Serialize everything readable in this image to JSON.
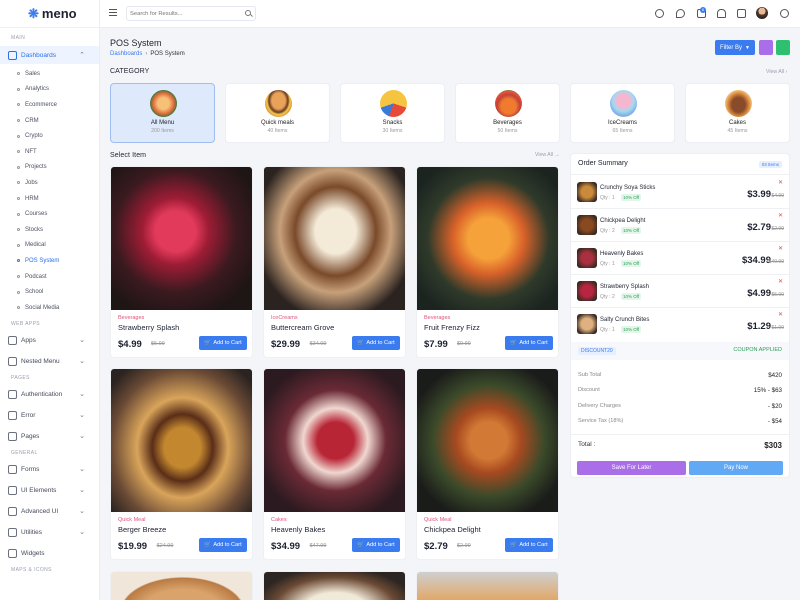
{
  "app": {
    "logo_text": "meno",
    "logo_mark": "❋"
  },
  "search": {
    "placeholder": "Search for Results..."
  },
  "topbar": {
    "notification_count": "6"
  },
  "sidebar": {
    "sections": {
      "main": "MAIN",
      "web_apps": "WEB APPS",
      "pages": "PAGES",
      "general": "GENERAL",
      "maps": "MAPS & ICONS"
    },
    "dashboards": "Dashboards",
    "sub_items": [
      "Sales",
      "Analytics",
      "Ecommerce",
      "CRM",
      "Crypto",
      "NFT",
      "Projects",
      "Jobs",
      "HRM",
      "Courses",
      "Stocks",
      "Medical",
      "POS System",
      "Podcast",
      "School",
      "Social Media"
    ],
    "apps": "Apps",
    "nested_menu": "Nested Menu",
    "authentication": "Authentication",
    "error": "Error",
    "pages": "Pages",
    "forms": "Forms",
    "ui_elements": "UI Elements",
    "advanced_ui": "Advanced UI",
    "utilities": "Utilities",
    "widgets": "Widgets"
  },
  "page": {
    "title": "POS System",
    "breadcrumb": [
      "Dashboards",
      "POS System"
    ],
    "filter_label": "Filter By",
    "category_heading": "CATEGORY",
    "select_heading": "Select Item",
    "view_all": "View All"
  },
  "categories": [
    {
      "name": "All Menu",
      "count": "200 Items"
    },
    {
      "name": "Quick meals",
      "count": "40 Items"
    },
    {
      "name": "Snacks",
      "count": "30 Items"
    },
    {
      "name": "Beverages",
      "count": "50 Items"
    },
    {
      "name": "IceCreams",
      "count": "65 Items"
    },
    {
      "name": "Cakes",
      "count": "45 Items"
    }
  ],
  "items": [
    {
      "category": "Beverages",
      "name": "Strawberry Splash",
      "price": "$4.99",
      "old_price": "$5.99"
    },
    {
      "category": "IceCreams",
      "name": "Buttercream Grove",
      "price": "$29.99",
      "old_price": "$34.99"
    },
    {
      "category": "Beverages",
      "name": "Fruit Frenzy Fizz",
      "price": "$7.99",
      "old_price": "$9.99"
    },
    {
      "category": "Quick Meal",
      "name": "Berger Breeze",
      "price": "$19.99",
      "old_price": "$24.99"
    },
    {
      "category": "Cakes",
      "name": "Heavenly Bakes",
      "price": "$34.99",
      "old_price": "$47.99"
    },
    {
      "category": "Quick Meal",
      "name": "Chickpea Delight",
      "price": "$2.79",
      "old_price": "$2.99"
    }
  ],
  "add_to_cart": "Add to Cart",
  "order": {
    "title": "Order Summary",
    "badge": "03 Items",
    "lines": [
      {
        "name": "Crunchy Soya Sticks",
        "qty": "Qty : 1",
        "off": "10% Off",
        "price": "$3.99",
        "old": "$4.99"
      },
      {
        "name": "Chickpea Delight",
        "qty": "Qty : 2",
        "off": "10% Off",
        "price": "$2.79",
        "old": "$2.99"
      },
      {
        "name": "Heavenly Bakes",
        "qty": "Qty : 1",
        "off": "10% Off",
        "price": "$34.99",
        "old": "$49.99"
      },
      {
        "name": "Strawberry Splash",
        "qty": "Qty : 2",
        "off": "10% Off",
        "price": "$4.99",
        "old": "$5.99"
      },
      {
        "name": "Salty Crunch Bites",
        "qty": "Qty : 1",
        "off": "10% Off",
        "price": "$1.29",
        "old": "$1.99"
      }
    ],
    "coupon": "DISCOUNT20",
    "coupon_status": "COUPON APPLIED",
    "sub_total_label": "Sub Total",
    "sub_total": "$420",
    "discount_label": "Discount",
    "discount": "15% - $63",
    "delivery_label": "Delivery Charges",
    "delivery": "- $20",
    "tax_label": "Service Tax (18%)",
    "tax": "- $54",
    "total_label": "Total :",
    "total": "$303",
    "save_label": "Save For Later",
    "pay_label": "Pay Now"
  },
  "colors": {
    "accent": "#3b7bf0",
    "offer_pink": "#e0537c",
    "success": "#2aa05a",
    "save_purple": "#a96ee8"
  }
}
